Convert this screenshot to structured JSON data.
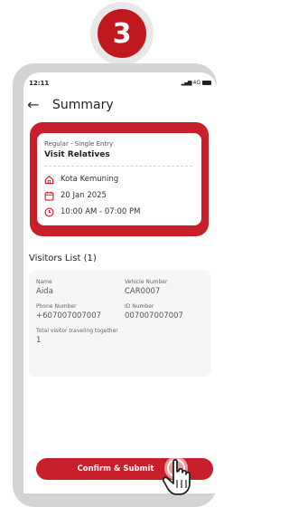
{
  "step_badge": "3",
  "status_bar": {
    "time": "12:11",
    "network": "4G"
  },
  "header": {
    "back_icon": "←",
    "title": "Summary"
  },
  "summary": {
    "entry_type": "Regular - Single Entry",
    "purpose": "Visit Relatives",
    "location": "Kota Kemuning",
    "date": "20 Jan 2025",
    "time_range": "10:00 AM - 07:00 PM"
  },
  "visitors": {
    "title": "Visitors List (1)",
    "fields": {
      "name_label": "Name",
      "name_value": "Aida",
      "vehicle_label": "Vehicle Number",
      "vehicle_value": "CAR0007",
      "phone_label": "Phone Number",
      "phone_value": "+607007007007",
      "id_label": "ID Number",
      "id_value": "007007007007",
      "together_label": "Total visitor traveling together",
      "together_value": "1"
    }
  },
  "confirm_button": "Confirm & Submit",
  "colors": {
    "accent": "#c91f2a",
    "badge": "#c0181f"
  }
}
